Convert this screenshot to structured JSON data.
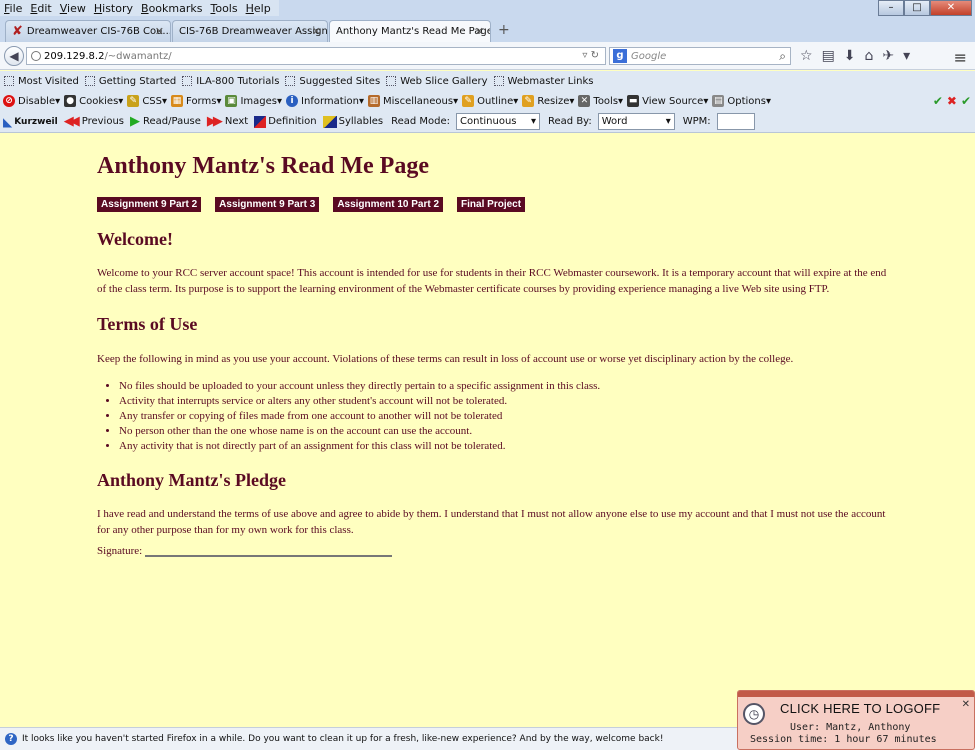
{
  "menubar": [
    "File",
    "Edit",
    "View",
    "History",
    "Bookmarks",
    "Tools",
    "Help"
  ],
  "tabs": [
    {
      "label": "Dreamweaver CIS-76B Cou..."
    },
    {
      "label": "CIS-76B Dreamweaver Assignm..."
    },
    {
      "label": "Anthony Mantz's Read Me Page"
    }
  ],
  "url": {
    "host": "209.129.8.2",
    "path": "/~dwamantz/"
  },
  "search": {
    "placeholder": "Google"
  },
  "bookmarks": [
    "Most Visited",
    "Getting Started",
    "ILA-800 Tutorials",
    "Suggested Sites",
    "Web Slice Gallery",
    "Webmaster Links"
  ],
  "devtools": [
    "Disable",
    "Cookies",
    "CSS",
    "Forms",
    "Images",
    "Information",
    "Miscellaneous",
    "Outline",
    "Resize",
    "Tools",
    "View Source",
    "Options"
  ],
  "kurzweil": {
    "logo": "Kurzweil",
    "previous": "Previous",
    "readpause": "Read/Pause",
    "next": "Next",
    "definition": "Definition",
    "syllables": "Syllables",
    "read_mode_label": "Read Mode:",
    "read_mode_value": "Continuous",
    "read_by_label": "Read By:",
    "read_by_value": "Word",
    "wpm_label": "WPM:"
  },
  "page": {
    "title": "Anthony Mantz's Read Me Page",
    "assignments": [
      "Assignment 9 Part 2",
      "Assignment 9 Part 3",
      "Assignment 10 Part 2",
      "Final Project"
    ],
    "welcome_heading": "Welcome!",
    "welcome_text": "Welcome to your RCC server account space! This account is intended for use for students in their RCC Webmaster coursework. It is a temporary account that will expire at the end of the class term. Its purpose is to support the learning environment of the Webmaster certificate courses by providing experience managing a live Web site using FTP.",
    "terms_heading": "Terms of Use",
    "terms_text": "Keep the following in mind as you use your account. Violations of these terms can result in loss of account use or worse yet disciplinary action by the college.",
    "rules": [
      "No files should be uploaded to your account unless they directly pertain to a specific assignment in this class.",
      "Activity that interrupts service or alters any other student's account will not be tolerated.",
      "Any transfer or copying of files made from one account to another will not be tolerated",
      "No person other than the one whose name is on the account can use the account.",
      "Any activity that is not directly part of an assignment for this class will not be tolerated."
    ],
    "pledge_heading": "Anthony Mantz's Pledge",
    "pledge_text": "I have read and understand the terms of use above and agree to abide by them. I understand that I must not allow anyone else to use my account and that I must not use the account for any other purpose than for my own work for this class.",
    "signature_label": "Signature:"
  },
  "status": {
    "message": "It looks like you haven't started Firefox in a while. Do you want to clean it up for a fresh, like-new experience? And by the way, welcome back!"
  },
  "logoff": {
    "title": "CLICK HERE TO LOGOFF",
    "user": "User:  Mantz, Anthony",
    "session": "Session time:  1 hour  67 minutes"
  }
}
